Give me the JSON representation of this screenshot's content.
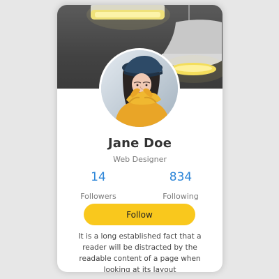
{
  "profile": {
    "name": "Jane Doe",
    "title": "Web Designer",
    "stats": [
      {
        "value": "14",
        "label": "Followers"
      },
      {
        "value": "834",
        "label": "Following"
      }
    ],
    "follow_label": "Follow",
    "bio": "It is a long established fact that a reader will be distracted by the readable content of a page when looking at its layout"
  },
  "colors": {
    "accent_button": "#f9c81d",
    "stat_value": "#2d86d8",
    "card_bg": "#ffffff",
    "page_bg": "#e7e7e7"
  },
  "icons": {
    "cover": "pendant-lamps-cover",
    "avatar": "profile-photo"
  }
}
